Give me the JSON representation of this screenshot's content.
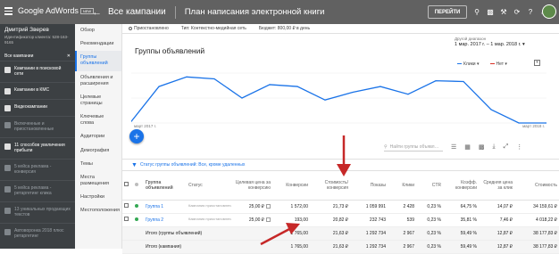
{
  "topbar": {
    "brand": "Google AdWords",
    "badge": "NEW",
    "back_icon": "arrow-left-icon",
    "crumb_all": "Все кампании",
    "crumb_page": "План написания электронной книги",
    "goto": "ПЕРЕЙТИ",
    "icons": [
      "search-icon",
      "chart-icon",
      "wrench-icon",
      "refresh-icon",
      "help-icon",
      "bell-icon"
    ]
  },
  "account": {
    "name": "Дмитрий Зверев",
    "id_line1": "Идентификатор клиента: 528-163-",
    "id_line2": "9165",
    "all_campaigns": "Все кампании"
  },
  "sidebar": [
    {
      "label": "Кампании в поисковой сети",
      "faded": false
    },
    {
      "label": "Кампании в КМС",
      "faded": false
    },
    {
      "label": "Видеокампании",
      "faded": false
    },
    {
      "label": "Включенные и приостановленные",
      "faded": true
    },
    {
      "label": "11 способов увеличения прибыли",
      "faded": false
    },
    {
      "label": "5 кейса реклама - конверсия",
      "faded": true
    },
    {
      "label": "5 кейса реклама - ретаргетинг клика",
      "faded": true
    },
    {
      "label": "13 уникальных продающих текстов",
      "faded": true
    },
    {
      "label": "Автоворонка 2018 плюс ретаргетинг",
      "faded": true
    }
  ],
  "nav2": [
    {
      "label": "Обзор",
      "active": false
    },
    {
      "label": "Рекомендации",
      "active": false
    },
    {
      "label": "Группы объявлений",
      "active": true
    },
    {
      "label": "Объявления и расширения",
      "active": false
    },
    {
      "label": "Целевые страницы",
      "active": false
    },
    {
      "label": "Ключевые слова",
      "active": false
    },
    {
      "label": "Аудитории",
      "active": false
    },
    {
      "label": "Демография",
      "active": false
    },
    {
      "label": "Темы",
      "active": false
    },
    {
      "label": "Места размещения",
      "active": false
    },
    {
      "label": "Настройки",
      "active": false
    },
    {
      "label": "Местоположения",
      "active": false
    }
  ],
  "status": {
    "state": "Приостановлено",
    "type": "Тип: Контекстно-медийная сеть",
    "budget": "Бюджет: 800,00 ₽ в день"
  },
  "section_title": "Группы объявлений",
  "date": {
    "label": "Другой диапазон",
    "value": "1 мар. 2017 г. – 1 мар. 2018 г."
  },
  "legend": {
    "s1": "Клики",
    "s2": "Нет",
    "s1_color": "#1a73e8",
    "s2_color": "#d93025"
  },
  "chart_data": {
    "type": "line",
    "x_start_label": "март 2017 г.",
    "x_end_label": "март 2018 г.",
    "series": [
      {
        "name": "Клики",
        "values": [
          4,
          95,
          120,
          115,
          65,
          100,
          95,
          60,
          80,
          95,
          75,
          110,
          108,
          35,
          0,
          0
        ]
      }
    ]
  },
  "toolbar": {
    "search_placeholder": "Найти группы объявл…"
  },
  "filter_text": "Статус группы объявлений: Все, кроме удаленных",
  "table": {
    "headers": [
      "",
      "",
      "Группа объявлений",
      "Статус",
      "Целевая цена за конверсию",
      "Конверсии",
      "Стоимость/конверсия",
      "Показы",
      "Клики",
      "CTR",
      "Коэфф. конверсии",
      "Средняя цена за клик",
      "Стоимость"
    ],
    "rows": [
      {
        "name": "Группа 1",
        "status": "Кампания приостановлена",
        "bid": "25,00 ₽",
        "conv": "1 572,00",
        "cpa": "21,73 ₽",
        "impr": "1 059 991",
        "clicks": "2 428",
        "ctr": "0,23 %",
        "cr": "64,75 %",
        "cpc": "14,07 ₽",
        "cost": "34 159,61 ₽"
      },
      {
        "name": "Группа 2",
        "status": "Кампания приостановлена",
        "bid": "25,00 ₽",
        "conv": "193,00",
        "cpa": "20,82 ₽",
        "impr": "232 743",
        "clicks": "539",
        "ctr": "0,23 %",
        "cr": "35,81 %",
        "cpc": "7,46 ₽",
        "cost": "4 018,22 ₽"
      }
    ],
    "totals": [
      {
        "label": "Итого (группы объявлений)",
        "bid": "",
        "conv": "1 765,00",
        "cpa": "21,63 ₽",
        "impr": "1 292 734",
        "clicks": "2 967",
        "ctr": "0,23 %",
        "cr": "59,49 %",
        "cpc": "12,87 ₽",
        "cost": "38 177,83 ₽"
      },
      {
        "label": "Итого (кампания)",
        "bid": "",
        "conv": "1 765,00",
        "cpa": "21,63 ₽",
        "impr": "1 292 734",
        "clicks": "2 967",
        "ctr": "0,23 %",
        "cr": "59,49 %",
        "cpc": "12,87 ₽",
        "cost": "38 177,83 ₽"
      }
    ]
  },
  "colors": {
    "accent": "#1a73e8",
    "annotation_arrow": "#c62828",
    "status_green": "#34a853"
  }
}
